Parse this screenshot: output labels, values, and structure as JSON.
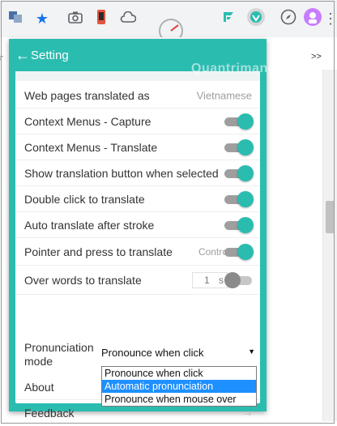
{
  "toolbar": {
    "icons": [
      "translate-icon",
      "bookmark-star-icon",
      "camera-icon",
      "phone-icon",
      "cloud-icon",
      "gauge-icon",
      "extension-icon",
      "vpn-icon",
      "compass-icon",
      "profile-avatar-icon",
      "more-icon"
    ],
    "avatar_color": "#c77dff"
  },
  "watermark": "Quantrimang",
  "popup": {
    "back_symbol": "←",
    "title": "Setting",
    "accent_color": "#2bbcb0"
  },
  "settings": {
    "web_pages_translated_as": {
      "label": "Web pages translated as",
      "value": "Vietnamese"
    },
    "context_capture": {
      "label": "Context Menus - Capture",
      "enabled": true
    },
    "context_translate": {
      "label": "Context Menus - Translate",
      "enabled": true
    },
    "show_translation_button": {
      "label": "Show translation button when selected",
      "enabled": true
    },
    "double_click": {
      "label": "Double click to translate",
      "enabled": true
    },
    "auto_translate": {
      "label": "Auto translate after stroke",
      "enabled": true
    },
    "pointer_press": {
      "label": "Pointer and press to translate",
      "value": "Contro",
      "enabled": true
    },
    "over_words": {
      "label": "Over words to translate",
      "number": "1",
      "unit": "s",
      "enabled": false
    },
    "pronunciation_mode": {
      "label": "Pronunciation mode",
      "selected": "Pronounce when click",
      "options": [
        "Pronounce when click",
        "Automatic pronunciation",
        "Pronounce when mouse over"
      ],
      "highlighted_option_index": 1
    },
    "about": {
      "label": "About"
    },
    "feedback": {
      "label": "Feedback",
      "arrow": "→"
    }
  }
}
